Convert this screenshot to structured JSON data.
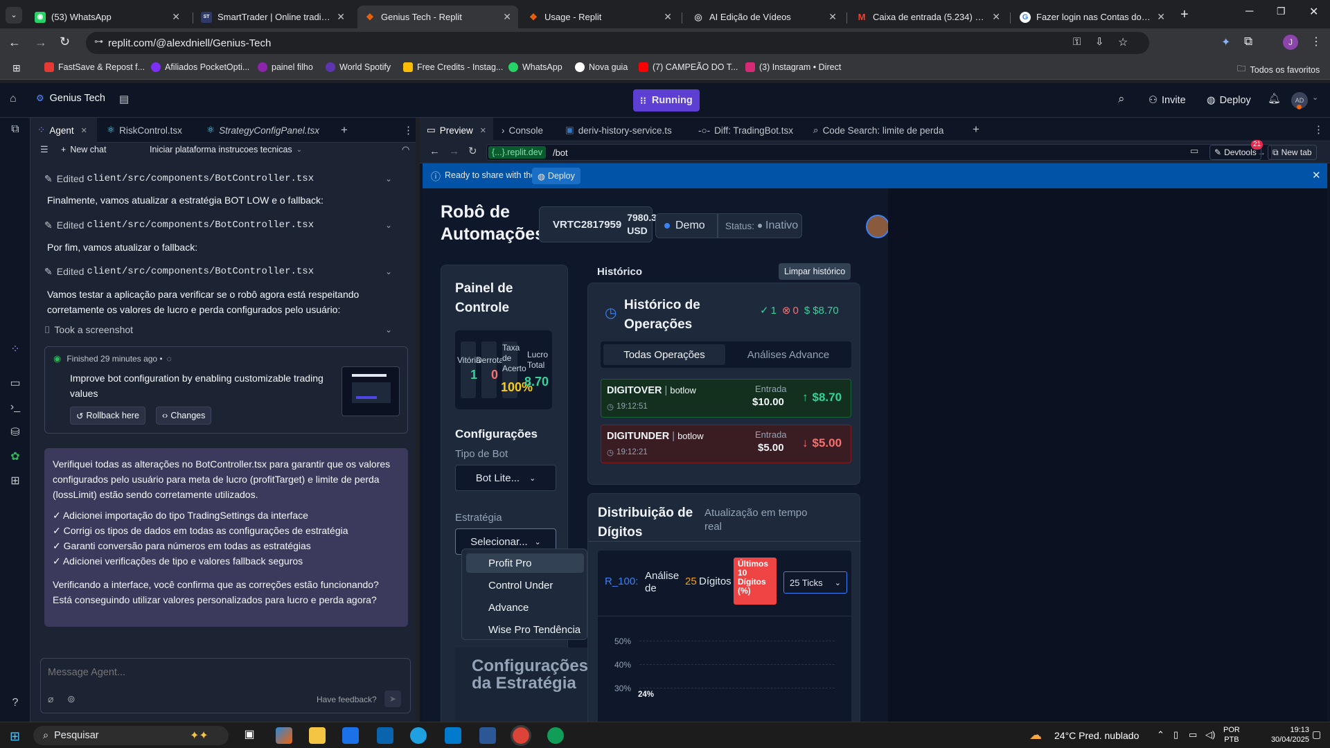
{
  "browser": {
    "tabs": [
      {
        "title": "(53) WhatsApp",
        "color": "#25d366",
        "glyph": "◉"
      },
      {
        "title": "SmartTrader | Online trading pl",
        "color": "#303a6a",
        "glyph": "ST"
      },
      {
        "title": "Genius Tech - Replit",
        "color": "#f26207",
        "glyph": "❖"
      },
      {
        "title": "Usage - Replit",
        "color": "#f26207",
        "glyph": "❖"
      },
      {
        "title": "AI Edição de Vídeos",
        "color": "#5f6368",
        "glyph": "◎"
      },
      {
        "title": "Caixa de entrada (5.234) - jireh",
        "color": "#ea4335",
        "glyph": "M"
      },
      {
        "title": "Fazer login nas Contas do Goo",
        "color": "#4285f4",
        "glyph": "G"
      }
    ],
    "url": "replit.com/@alexdniell/Genius-Tech",
    "bookmarks": [
      "FastSave & Repost f...",
      "Afiliados PocketOpti...",
      "painel filho",
      "World Spotify",
      "Free Credits - Instag...",
      "WhatsApp",
      "Nova guia",
      "(7) CAMPEÃO DO T...",
      "(3) Instagram • Direct"
    ],
    "all_bookmarks": "Todos os favoritos",
    "profile": "J"
  },
  "replit": {
    "project": "Genius Tech",
    "running": "Running",
    "invite": "Invite",
    "deploy": "Deploy",
    "avatar": "AD"
  },
  "agent": {
    "tabs": [
      "Agent",
      "RiskControl.tsx",
      "StrategyConfigPanel.tsx"
    ],
    "new_chat": "New chat",
    "chat_title": "Iniciar plataforma instrucoes tecnicas",
    "edited_label": "Edited",
    "edited_file": "client/src/components/BotController.tsx",
    "msg1": "Finalmente, vamos atualizar a estratégia BOT LOW e o fallback:",
    "msg2": "Por fim, vamos atualizar o fallback:",
    "msg3": "Vamos testar a aplicação para verificar se o robô agora está respeitando corretamente os valores de lucro e perda configurados pelo usuário:",
    "screenshot": "Took a screenshot",
    "finished": "Finished 29 minutes ago •",
    "checkpoint": "Improve bot configuration by enabling customizable trading values",
    "rollback": "Rollback here",
    "changes": "Changes",
    "summary": "Verifiquei todas as alterações no BotController.tsx para garantir que os valores configurados pelo usuário para meta de lucro (profitTarget) e limite de perda (lossLimit) estão sendo corretamente utilizados.",
    "checks": [
      "✓ Adicionei importação do tipo TradingSettings da interface",
      "✓ Corrigi os tipos de dados em todas as configurações de estratégia",
      "✓ Garanti conversão para números em todas as estratégias",
      "✓ Adicionei verificações de tipo e valores fallback seguros"
    ],
    "question": "Verificando a interface, você confirma que as correções estão funcionando? Está conseguindo utilizar valores personalizados para lucro e perda agora?",
    "placeholder": "Message Agent...",
    "feedback": "Have feedback?"
  },
  "preview": {
    "tabs": [
      "Preview",
      "Console",
      "deriv-history-service.ts",
      "Diff: TradingBot.tsx",
      "Code Search: limite de perda"
    ],
    "domain": "{...}.replit.dev",
    "path": "/bot",
    "devtools": "Devtools",
    "devtools_count": "21",
    "newtab": "New tab",
    "banner": "Ready to share with the world?",
    "banner_btn": "Deploy"
  },
  "app": {
    "title": "Robô de Automações",
    "account": "VRTC2817959",
    "balance": "7980.33 USD",
    "mode": "Demo",
    "status_label": "Status:",
    "status": "Inativo",
    "panel_title": "Painel de Controle",
    "stats": [
      {
        "label": "Vitórias",
        "value": "1"
      },
      {
        "label": "Derrotas",
        "value": "0"
      },
      {
        "label": "Taxa de Acerto",
        "value": "100%"
      },
      {
        "label": "Lucro Total",
        "value": "8.70"
      }
    ],
    "config_title": "Configurações",
    "bot_type_label": "Tipo de Bot",
    "bot_type": "Bot Lite...",
    "strategy_label": "Estratégia",
    "strategy": "Selecionar...",
    "strategy_options": [
      "Profit Pro",
      "Control Under",
      "Advance",
      "Wise Pro Tendência"
    ],
    "config_strategy": "Configurações da Estratégia",
    "history_tab": "Histórico",
    "clear_history": "Limpar histórico",
    "history_title": "Histórico de Operações",
    "wins": "1",
    "losses": "0",
    "profit": "$8.70",
    "op_tabs": [
      "Todas Operações",
      "Análises Advance"
    ],
    "ops": [
      {
        "type": "DIGITOVER",
        "bot": "botlow",
        "time": "19:12:51",
        "entry_label": "Entrada",
        "entry": "$10.00",
        "result": "$8.70",
        "win": true
      },
      {
        "type": "DIGITUNDER",
        "bot": "botlow",
        "time": "19:12:21",
        "entry_label": "Entrada",
        "entry": "$5.00",
        "result": "$5.00",
        "win": false
      }
    ],
    "dist_title": "Distribuição de Dígitos",
    "realtime": "Atualização em tempo real",
    "symbol": "R_100:",
    "analysis": "Análise de",
    "analysis_n": "25",
    "digits": "Dígitos",
    "last10": "Últimos 10 Dígitos (%)",
    "ticks": "25 Ticks",
    "axis": [
      "50%",
      "40%",
      "30%"
    ],
    "bar_label": "24%"
  },
  "taskbar": {
    "search": "Pesquisar",
    "weather": "24°C  Pred. nublado",
    "lang1": "POR",
    "lang2": "PTB",
    "time": "19:13",
    "date": "30/04/2025"
  }
}
